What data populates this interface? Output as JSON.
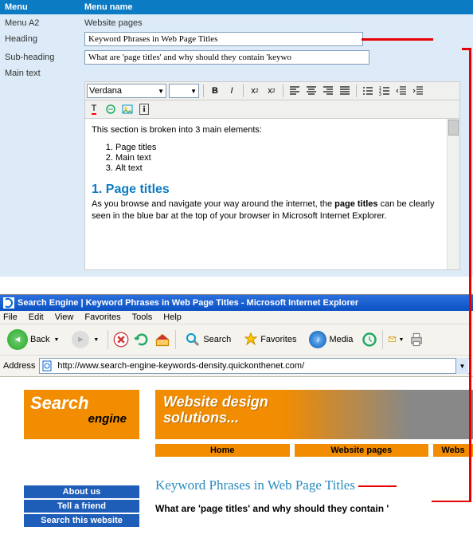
{
  "form": {
    "header_col1": "Menu",
    "header_col2": "Menu name",
    "menu_label": "Menu A2",
    "menu_value": "Website pages",
    "heading_label": "Heading",
    "heading_value": "Keyword Phrases in Web Page Titles",
    "sub_label": "Sub-heading",
    "sub_value": "What are 'page titles' and why should they contain 'keywo",
    "maintext_label": "Main text"
  },
  "editor": {
    "font": "Verdana",
    "intro": "This section is broken into 3 main elements:",
    "items": [
      "Page titles",
      "Main text",
      "Alt text"
    ],
    "h1": "1. Page titles",
    "p1a": "As you browse and navigate your way around the internet, the ",
    "p1b": "page titles",
    "p1c": " can be clearly seen in the blue bar at the top of your browser in Microsoft Internet Explorer."
  },
  "browser": {
    "title": "Search Engine | Keyword Phrases in Web Page Titles - Microsoft Internet Explorer",
    "menus": [
      "File",
      "Edit",
      "View",
      "Favorites",
      "Tools",
      "Help"
    ],
    "back": "Back",
    "search": "Search",
    "favorites": "Favorites",
    "media": "Media",
    "address_label": "Address",
    "url": "http://www.search-engine-keywords-density.quickonthenet.com/"
  },
  "site": {
    "logo1": "Search",
    "logo2": "engine",
    "banner1": "Website design",
    "banner2": "solutions...",
    "tabs": [
      "Home",
      "Website pages",
      "Webs"
    ],
    "side": [
      "About us",
      "Tell a friend",
      "Search this website"
    ],
    "page_title": "Keyword Phrases in Web Page Titles",
    "page_sub": "What are 'page titles' and why should they contain '"
  }
}
